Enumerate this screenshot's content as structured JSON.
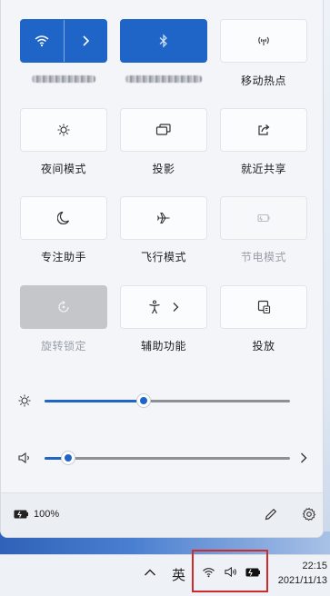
{
  "tiles": {
    "wifi": {
      "label_blurred": true
    },
    "bluetooth": {
      "label_blurred": true
    },
    "hotspot": {
      "label": "移动热点"
    },
    "night_light": {
      "label": "夜间模式"
    },
    "project": {
      "label": "投影"
    },
    "nearby_share": {
      "label": "就近共享"
    },
    "focus_assist": {
      "label": "专注助手"
    },
    "airplane": {
      "label": "飞行模式"
    },
    "battery_saver": {
      "label": "节电模式"
    },
    "rotation_lock": {
      "label": "旋转锁定"
    },
    "accessibility": {
      "label": "辅助功能"
    },
    "cast": {
      "label": "投放"
    }
  },
  "sliders": {
    "brightness": {
      "value_fraction": 0.41
    },
    "volume": {
      "value_fraction": 0.1
    }
  },
  "footer": {
    "battery_text": "100%"
  },
  "taskbar": {
    "ime": "英",
    "time": "22:15",
    "date": "2021/11/13"
  },
  "colors": {
    "accent": "#1f65c8",
    "highlight_box": "#d12a2a"
  }
}
